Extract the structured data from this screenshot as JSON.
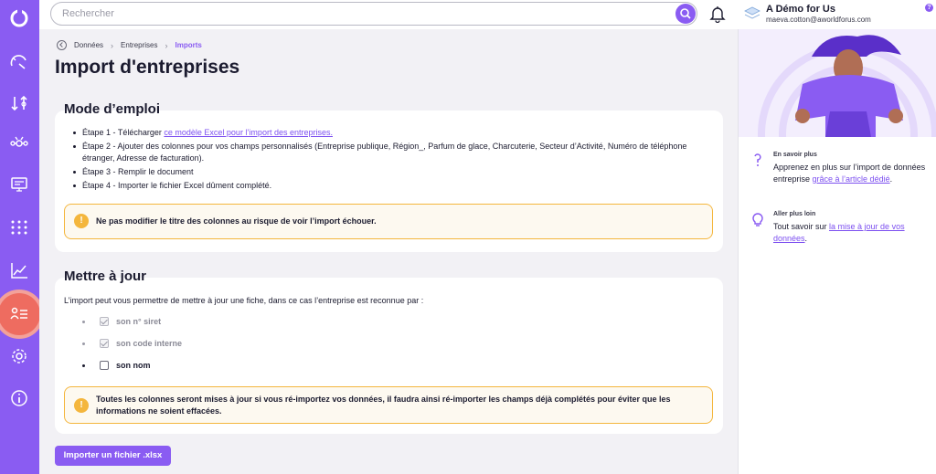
{
  "search": {
    "placeholder": "Rechercher"
  },
  "user": {
    "name": "A Démo for Us",
    "email": "maeva.cotton@aworldforus.com"
  },
  "help_badge": "?",
  "breadcrumb": {
    "items": [
      "Données",
      "Entreprises"
    ],
    "current": "Imports"
  },
  "page_title": "Import d'entreprises",
  "mode_emploi": {
    "title": "Mode d’emploi",
    "step1_prefix": "Étape 1 - Télécharger ",
    "step1_link": "ce modèle Excel pour l’import des entreprises.",
    "step2": "Étape 2 - Ajouter des colonnes pour vos champs personnalisés (Entreprise publique, Région_, Parfum de glace, Charcuterie, Secteur d’Activité, Numéro de téléphone étranger, Adresse de facturation).",
    "step3": "Étape 3 - Remplir le document",
    "step4": "Étape 4 - Importer le fichier Excel dûment complété.",
    "alert": "Ne pas modifier le titre des colonnes au risque de voir l’import échouer."
  },
  "mettre_a_jour": {
    "title": "Mettre à jour",
    "intro": "L’import peut vous permettre de mettre à jour une fiche, dans ce cas l’entreprise est reconnue par :",
    "options": [
      {
        "label": "son n° siret",
        "checked": true,
        "disabled": true
      },
      {
        "label": "son code interne",
        "checked": true,
        "disabled": true
      },
      {
        "label": "son nom",
        "checked": false,
        "disabled": false
      }
    ],
    "alert": "Toutes les colonnes seront mises à jour si vous ré-importez vos données, il faudra ainsi ré-importer les champs déjà complétés pour éviter que les informations ne soient effacées."
  },
  "import_button": "Importer un fichier .xlsx",
  "right_panel": {
    "tip1": {
      "head": "En savoir plus",
      "text": "Apprenez en plus sur l’import de données entreprise ",
      "link": "grâce à l’article dédié",
      "suffix": "."
    },
    "tip2": {
      "head": "Aller plus loin",
      "text": "Tout savoir sur ",
      "link": "la mise à jour de vos données",
      "suffix": "."
    }
  },
  "alert_icon": "!",
  "colors": {
    "accent": "#8a5cf2",
    "active_nav": "#ee6c60",
    "warning": "#f4b63d",
    "link": "#7c4ff0"
  },
  "icons": {
    "sidebar": [
      "logo-icon",
      "speedometer-icon",
      "exchange-icon",
      "network-icon",
      "monitor-icon",
      "grid-dots-icon",
      "chart-line-icon",
      "users-list-icon",
      "settings-icon",
      "info-icon"
    ],
    "top": [
      "search-icon",
      "bell-icon",
      "avatar-icon"
    ]
  }
}
